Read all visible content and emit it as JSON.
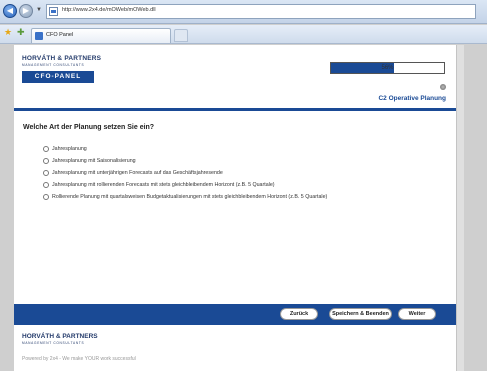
{
  "browser": {
    "url": "http://www.2x4.de/mOWeb/mOWeb.dll",
    "tab_title": "CFO Panel",
    "back_glyph": "◀",
    "forward_glyph": "▶",
    "icons": [
      "back-arrow-icon",
      "forward-arrow-icon",
      "page-icon",
      "favorites-star-icon",
      "add-favorites-icon"
    ]
  },
  "header": {
    "logo_name": "HORVÁTH & PARTNERS",
    "logo_sub": "MANAGEMENT CONSULTANTS",
    "panel_label": "CFO-PANEL",
    "progress_percent": 56,
    "progress_text": "56%",
    "section_title": "C2 Operative Planung"
  },
  "question": {
    "text": "Welche Art der Planung setzen Sie ein?",
    "selected": null,
    "options": [
      "Jahresplanung",
      "Jahresplanung mit Saisonalisierung",
      "Jahresplanung mit unterjährigen Forecasts auf das Geschäftsjahresende",
      "Jahresplanung mit rollierenden Forecasts mit stets gleichbleibendem Horizont (z.B. 5 Quartale)",
      "Rollierende Planung mit quartalsweisen Budgetaktualisierungen mit stets gleichbleibendem Horizont (z.B. 5 Quartale)"
    ]
  },
  "buttons": {
    "back": "Zurück",
    "save": "Speichern & Beenden",
    "next": "Weiter"
  },
  "footer": {
    "logo_name": "HORVÁTH & PARTNERS",
    "logo_sub": "MANAGEMENT CONSULTANTS",
    "powered": "Powered by 2x4 - We make YOUR work successful"
  },
  "colors": {
    "brand_blue": "#1a4a95",
    "background_gray": "#cfcfcf"
  }
}
